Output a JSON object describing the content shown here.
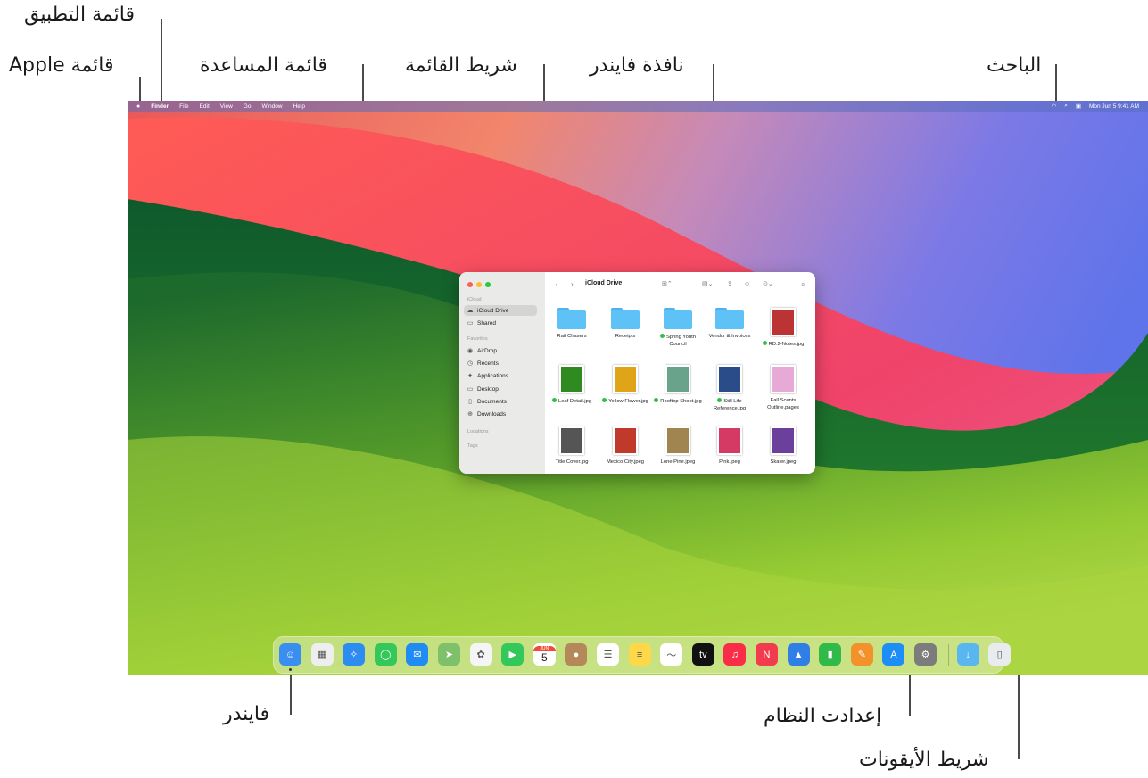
{
  "callouts": {
    "app_menu": "قائمة التطبيق",
    "apple_menu": "قائمة Apple",
    "help_menu": "قائمة المساعدة",
    "menu_bar": "شريط القائمة",
    "finder_window": "نافذة فايندر",
    "spotlight": "الباحث",
    "finder": "فايندر",
    "system_settings": "إعدادت النظام",
    "dock": "شريط الأيقونات"
  },
  "menubar": {
    "apple": "",
    "items": [
      "Finder",
      "File",
      "Edit",
      "View",
      "Go",
      "Window",
      "Help"
    ],
    "clock": "Mon Jun 5  9:41 AM"
  },
  "finder": {
    "title": "iCloud Drive",
    "sidebar": {
      "icloud_header": "iCloud",
      "icloud_items": [
        "iCloud Drive",
        "Shared"
      ],
      "favorites_header": "Favorites",
      "favorites_items": [
        "AirDrop",
        "Recents",
        "Applications",
        "Desktop",
        "Documents",
        "Downloads"
      ],
      "locations_header": "Locations",
      "tags_header": "Tags"
    },
    "files": [
      {
        "name": "Rail Chasers",
        "kind": "folder",
        "synced": false
      },
      {
        "name": "Receipts",
        "kind": "folder",
        "synced": false
      },
      {
        "name": "Spring Youth Council",
        "kind": "folder",
        "synced": true
      },
      {
        "name": "Vendor & Invoices",
        "kind": "folder",
        "synced": false
      },
      {
        "name": "RD.2-Notes.jpg",
        "kind": "image",
        "synced": true,
        "color": "#b33"
      },
      {
        "name": "Leaf Detail.jpg",
        "kind": "image",
        "synced": true,
        "color": "#2f8a1f"
      },
      {
        "name": "Yellow Flower.jpg",
        "kind": "image",
        "synced": true,
        "color": "#e0a418"
      },
      {
        "name": "Rooftop Shoot.jpg",
        "kind": "image",
        "synced": true,
        "color": "#6aa38b"
      },
      {
        "name": "Still Life Reference.jpg",
        "kind": "image",
        "synced": true,
        "color": "#2a4d8a"
      },
      {
        "name": "Fall Scents Outline.pages",
        "kind": "image",
        "synced": false,
        "color": "#e7a9d6"
      },
      {
        "name": "Title Cover.jpg",
        "kind": "image",
        "synced": false,
        "color": "#555"
      },
      {
        "name": "Mexico City.jpeg",
        "kind": "image",
        "synced": false,
        "color": "#c0392b"
      },
      {
        "name": "Lone Pine.jpeg",
        "kind": "image",
        "synced": false,
        "color": "#a08550"
      },
      {
        "name": "Pink.jpeg",
        "kind": "image",
        "synced": false,
        "color": "#d43a64"
      },
      {
        "name": "Skater.jpeg",
        "kind": "image",
        "synced": false,
        "color": "#6b3f9c"
      }
    ]
  },
  "dock": {
    "icons": [
      {
        "name": "finder-icon",
        "color": "#3a8ef0",
        "glyph": "☺"
      },
      {
        "name": "launchpad-icon",
        "color": "#eeeeee",
        "glyph": "▦"
      },
      {
        "name": "safari-icon",
        "color": "#2d8cf0",
        "glyph": "✧"
      },
      {
        "name": "messages-icon",
        "color": "#34c759",
        "glyph": "◯"
      },
      {
        "name": "mail-icon",
        "color": "#1f8bf3",
        "glyph": "✉"
      },
      {
        "name": "maps-icon",
        "color": "#7fc06a",
        "glyph": "➤"
      },
      {
        "name": "photos-icon",
        "color": "#f5f5f5",
        "glyph": "✿"
      },
      {
        "name": "facetime-icon",
        "color": "#34c759",
        "glyph": "▶"
      },
      {
        "name": "calendar-icon",
        "color": "#ffffff",
        "glyph": "5"
      },
      {
        "name": "contacts-icon",
        "color": "#b5885a",
        "glyph": "●"
      },
      {
        "name": "reminders-icon",
        "color": "#ffffff",
        "glyph": "☰"
      },
      {
        "name": "notes-icon",
        "color": "#ffd84a",
        "glyph": "≡"
      },
      {
        "name": "freeform-icon",
        "color": "#ffffff",
        "glyph": "〜"
      },
      {
        "name": "apple-tv-icon",
        "color": "#111111",
        "glyph": "tv"
      },
      {
        "name": "music-icon",
        "color": "#fa2d48",
        "glyph": "♫"
      },
      {
        "name": "news-icon",
        "color": "#f23b4e",
        "glyph": "N"
      },
      {
        "name": "keynote-icon",
        "color": "#2f7fe6",
        "glyph": "▲"
      },
      {
        "name": "numbers-icon",
        "color": "#31b94a",
        "glyph": "▮"
      },
      {
        "name": "pages-icon",
        "color": "#f3922b",
        "glyph": "✎"
      },
      {
        "name": "app-store-icon",
        "color": "#1c8ef5",
        "glyph": "A"
      },
      {
        "name": "system-settings-icon",
        "color": "#7c7c7c",
        "glyph": "⚙"
      },
      {
        "name": "downloads-folder-icon",
        "color": "#5ab6ee",
        "glyph": "↓"
      },
      {
        "name": "trash-icon",
        "color": "#e9ecef",
        "glyph": "▯"
      }
    ],
    "calendar_month": "JUN"
  }
}
